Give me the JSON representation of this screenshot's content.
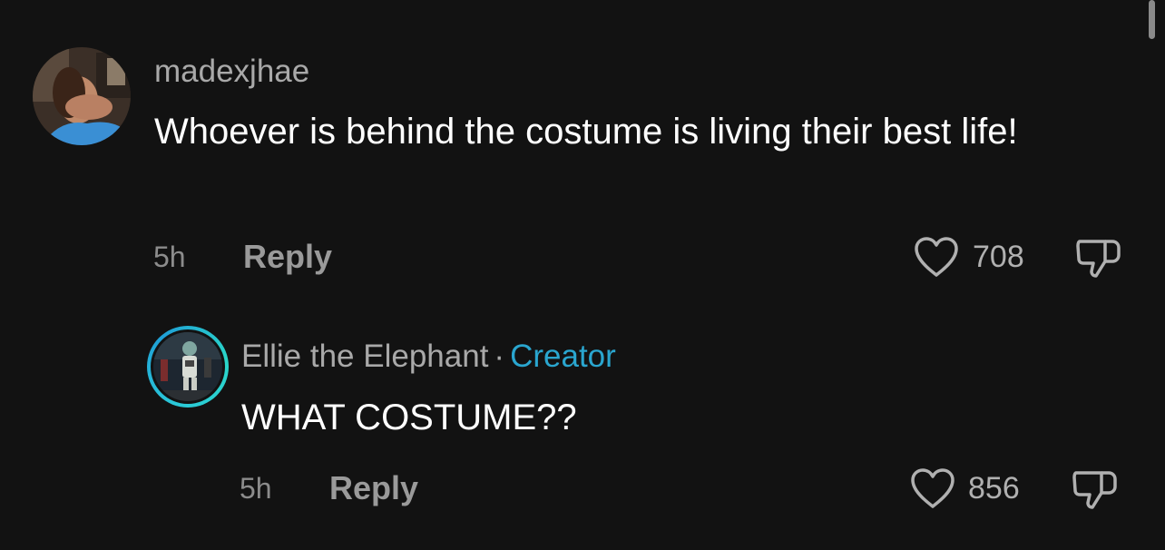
{
  "comments": [
    {
      "username": "madexjhae",
      "text": "Whoever is behind the costume is living their best life!",
      "time": "5h",
      "reply_label": "Reply",
      "likes": "708"
    }
  ],
  "reply": {
    "username": "Ellie the Elephant",
    "separator": "·",
    "badge": "Creator",
    "text": "WHAT COSTUME??",
    "time": "5h",
    "reply_label": "Reply",
    "likes": "856"
  },
  "colors": {
    "background": "#121212",
    "creator_badge": "#2aa6cf",
    "creator_ring": "#2ac8d8"
  },
  "icons": [
    "heart-icon",
    "dislike-icon"
  ]
}
